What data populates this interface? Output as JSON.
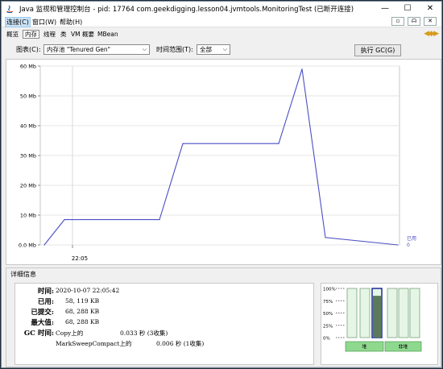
{
  "window": {
    "title": "Java 监视和管理控制台 - pid: 17764 com.geekdigging.lesson04.jvmtools.MonitoringTest (已断开连接)",
    "min_glyph": "—",
    "max_glyph": "☐",
    "close_glyph": "✕"
  },
  "menu": {
    "items": [
      "连接(C)",
      "窗口(W)",
      "帮助(H)"
    ],
    "mdi_buttons": [
      "▫",
      "ᗣ",
      "✕"
    ]
  },
  "tabs": {
    "items": [
      "概览",
      "内存",
      "线程",
      "类",
      "VM 概要",
      "MBean"
    ],
    "active": "内存",
    "arrows": "◀◆▶"
  },
  "controls": {
    "chart_label": "图表(C):",
    "chart_value": "内存池 \"Tenured Gen\"",
    "range_label": "时间范围(T):",
    "range_value": "全部",
    "gc_button": "执行 GC(G)"
  },
  "chart_data": {
    "type": "line",
    "y_ticks": [
      "60 Mb",
      "50 Mb",
      "40 Mb",
      "30 Mb",
      "20 Mb",
      "10 Mb",
      "0.0 Mb"
    ],
    "ylim": [
      0,
      60
    ],
    "x_tick_label": "22:05",
    "legend": "已用",
    "legend_value": "0",
    "points": [
      0,
      8.5,
      8.5,
      34,
      34,
      59,
      2.5,
      0
    ]
  },
  "details": {
    "header": "详细信息",
    "time_label": "时间:",
    "time_value": "2020-10-07 22:05:42",
    "used_label": "已用:",
    "used_value": "58, 119 KB",
    "committed_label": "已提交:",
    "committed_value": "68, 288 KB",
    "max_label": "最大值:",
    "max_value": "68, 288 KB",
    "gc_label": "GC 时间:",
    "gc_rows": [
      {
        "name": "Copy上的",
        "time": "0.033 秒 (3收集)"
      },
      {
        "name": "MarkSweepCompact上的",
        "time": "0.006 秒 (1收集)"
      }
    ]
  },
  "memviz": {
    "y_ticks": [
      "100%",
      "75%",
      "50%",
      "25%",
      "0%"
    ],
    "groups": [
      "堆",
      "非堆"
    ],
    "fills": [
      0,
      0,
      0.85,
      0,
      0,
      0
    ]
  },
  "colors": {
    "chart_line": "#4a4fc4",
    "bar_green": "#8fd98f",
    "bar_active": "#1a2a9a"
  }
}
